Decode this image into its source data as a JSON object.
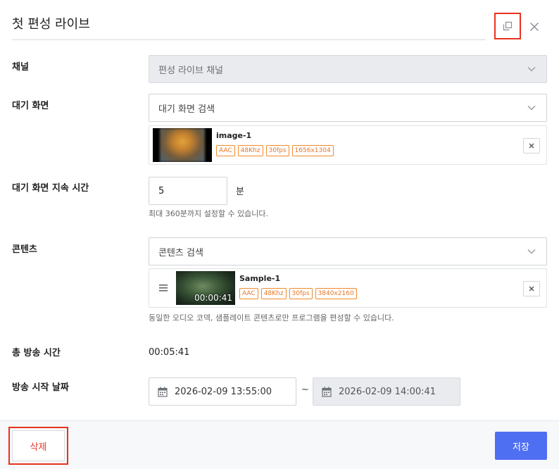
{
  "header": {
    "title": "첫 편성 라이브",
    "copy_icon": "copy-icon",
    "close_icon": "close-icon",
    "focus_color": "#e8321f"
  },
  "channel": {
    "label": "채널",
    "value": "편성 라이브 채널",
    "disabled": true
  },
  "standby_screen": {
    "label": "대기 화면",
    "placeholder": "대기 화면 검색",
    "item": {
      "name": "image-1",
      "tags": [
        "AAC",
        "48Khz",
        "30fps",
        "1656x1304"
      ]
    }
  },
  "standby_duration": {
    "label": "대기 화면 지속 시간",
    "value": "5",
    "unit": "분",
    "hint": "최대 360분까지 설정할 수 있습니다."
  },
  "contents": {
    "label": "콘텐츠",
    "placeholder": "콘텐츠 검색",
    "item": {
      "name": "Sample-1",
      "duration": "00:00:41",
      "tags": [
        "AAC",
        "48Khz",
        "30fps",
        "3840x2160"
      ]
    },
    "hint": "동일한 오디오 코덱, 샘플레이트 콘텐츠로만 프로그램을 편성할 수 있습니다."
  },
  "total_time": {
    "label": "총 방송 시간",
    "value": "00:05:41"
  },
  "start_date": {
    "label": "방송 시작 날짜",
    "start": "2026-02-09 13:55:00",
    "separator": "~",
    "end": "2026-02-09 14:00:41"
  },
  "footer": {
    "delete_label": "삭제",
    "save_label": "저장"
  },
  "colors": {
    "accent": "#4f6ff2",
    "delete_text": "#e23a2a",
    "tag_orange": "#f08a2a"
  }
}
